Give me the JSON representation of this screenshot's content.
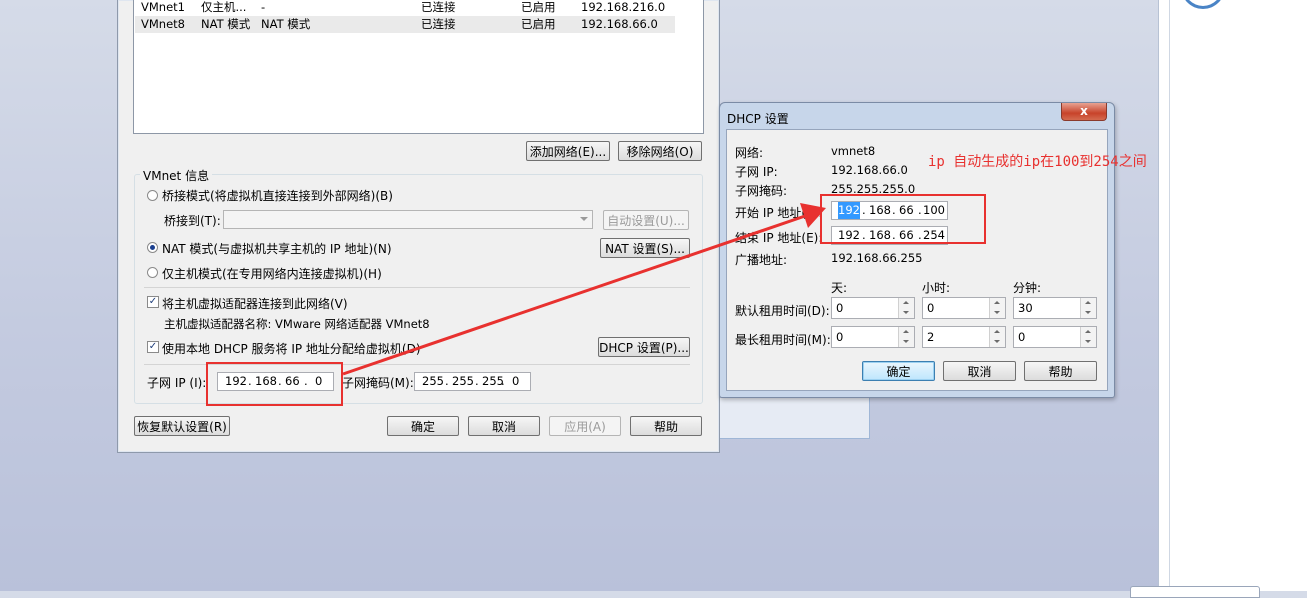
{
  "network_list": [
    {
      "name": "VMnet1",
      "type": "仅主机...",
      "external": "-",
      "host_connection": "已连接",
      "dhcp": "已启用",
      "subnet": "192.168.216.0"
    },
    {
      "name": "VMnet8",
      "type": "NAT 模式",
      "external": "NAT 模式",
      "host_connection": "已连接",
      "dhcp": "已启用",
      "subnet": "192.168.66.0"
    }
  ],
  "list_buttons": {
    "add": "添加网络(E)...",
    "remove": "移除网络(O)"
  },
  "vmnet_info": {
    "title": "VMnet 信息",
    "bridged_label": "桥接模式(将虚拟机直接连接到外部网络)(B)",
    "bridge_to_label": "桥接到(T):",
    "bridge_to_value": "",
    "auto_settings": "自动设置(U)...",
    "nat_label": "NAT 模式(与虚拟机共享主机的 IP 地址)(N)",
    "nat_settings": "NAT 设置(S)...",
    "hostonly_label": "仅主机模式(在专用网络内连接虚拟机)(H)",
    "connect_adapter_label": "将主机虚拟适配器连接到此网络(V)",
    "adapter_name_text": "主机虚拟适配器名称: VMware 网络适配器 VMnet8",
    "use_dhcp_label": "使用本地 DHCP 服务将 IP 地址分配给虚拟机(D)",
    "dhcp_settings": "DHCP 设置(P)...",
    "subnet_ip_label": "子网 IP (I):",
    "subnet_ip": [
      "192",
      "168",
      "66",
      "0"
    ],
    "subnet_mask_label": "子网掩码(M):",
    "subnet_mask": [
      "255",
      "255",
      "255",
      "0"
    ]
  },
  "main_buttons": {
    "restore": "恢复默认设置(R)",
    "ok": "确定",
    "cancel": "取消",
    "apply": "应用(A)",
    "help": "帮助"
  },
  "dhcp": {
    "title": "DHCP 设置",
    "close": "x",
    "network_label": "网络:",
    "network_value": "vmnet8",
    "subnet_ip_label": "子网 IP:",
    "subnet_ip_value": "192.168.66.0",
    "subnet_mask_label": "子网掩码:",
    "subnet_mask_value": "255.255.255.0",
    "start_ip_label": "开始 IP 地址(S):",
    "start_ip": [
      "192",
      "168",
      "66",
      "100"
    ],
    "end_ip_label": "结束 IP 地址(E):",
    "end_ip": [
      "192",
      "168",
      "66",
      "254"
    ],
    "broadcast_label": "广播地址:",
    "broadcast_value": "192.168.66.255",
    "col_days": "天:",
    "col_hours": "小时:",
    "col_minutes": "分钟:",
    "default_lease_label": "默认租用时间(D):",
    "default_lease": [
      "0",
      "0",
      "30"
    ],
    "max_lease_label": "最长租用时间(M):",
    "max_lease": [
      "0",
      "2",
      "0"
    ],
    "ok": "确定",
    "cancel": "取消",
    "help": "帮助"
  },
  "annotation": "ip 自动生成的ip在100到254之间",
  "colors": {
    "annotation_red": "#e8312f",
    "selection_blue": "#3399ff"
  }
}
